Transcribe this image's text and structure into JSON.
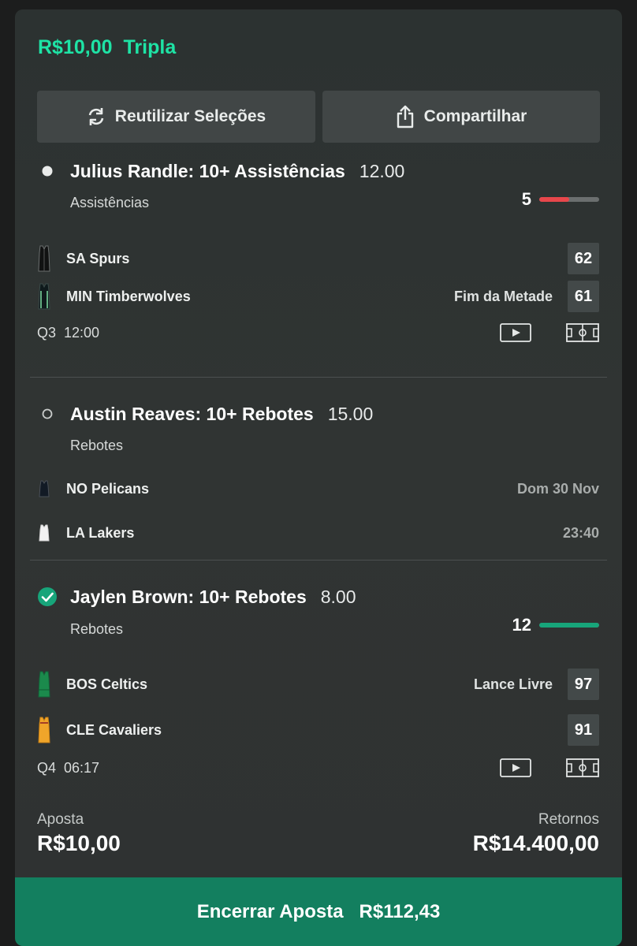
{
  "header": {
    "stake": "R$10,00",
    "bet_type": "Tripla"
  },
  "actions": {
    "reuse_label": "Reutilizar Seleções",
    "share_label": "Compartilhar"
  },
  "selections": [
    {
      "title": "Julius Randle: 10+ Assistências",
      "odds": "12.00",
      "market": "Assistências",
      "status": "open",
      "progress": {
        "value": "5",
        "fraction": 0.5,
        "color": "#e8474b"
      },
      "teams": [
        {
          "name": "SA Spurs",
          "score": "62",
          "jersey": "spurs"
        },
        {
          "name": "MIN Timberwolves",
          "score": "61",
          "jersey": "wolves",
          "status": "Fim da Metade"
        }
      ],
      "clock": {
        "period": "Q3",
        "time": "12:00"
      }
    },
    {
      "title": "Austin Reaves: 10+ Rebotes",
      "odds": "15.00",
      "market": "Rebotes",
      "status": "pending",
      "teams": [
        {
          "name": "NO Pelicans",
          "jersey": "pelicans"
        },
        {
          "name": "LA Lakers",
          "jersey": "lakers"
        }
      ],
      "date": "Dom 30 Nov",
      "time": "23:40"
    },
    {
      "title": "Jaylen Brown: 10+ Rebotes",
      "odds": "8.00",
      "market": "Rebotes",
      "status": "won",
      "progress": {
        "value": "12",
        "fraction": 1.0,
        "color": "#17a57a"
      },
      "teams": [
        {
          "name": "BOS Celtics",
          "score": "97",
          "jersey": "celtics",
          "status": "Lance Livre"
        },
        {
          "name": "CLE Cavaliers",
          "score": "91",
          "jersey": "cavs"
        }
      ],
      "clock": {
        "period": "Q4",
        "time": "06:17"
      }
    }
  ],
  "summary": {
    "stake_label": "Aposta",
    "stake_value": "R$10,00",
    "returns_label": "Retornos",
    "returns_value": "R$14.400,00"
  },
  "cashout": {
    "label": "Encerrar Aposta",
    "amount": "R$112,43"
  },
  "colors": {
    "accent": "#1ee3a5",
    "cashout_bg": "#137f5f",
    "progress_red": "#e8474b",
    "progress_green": "#17a57a"
  }
}
